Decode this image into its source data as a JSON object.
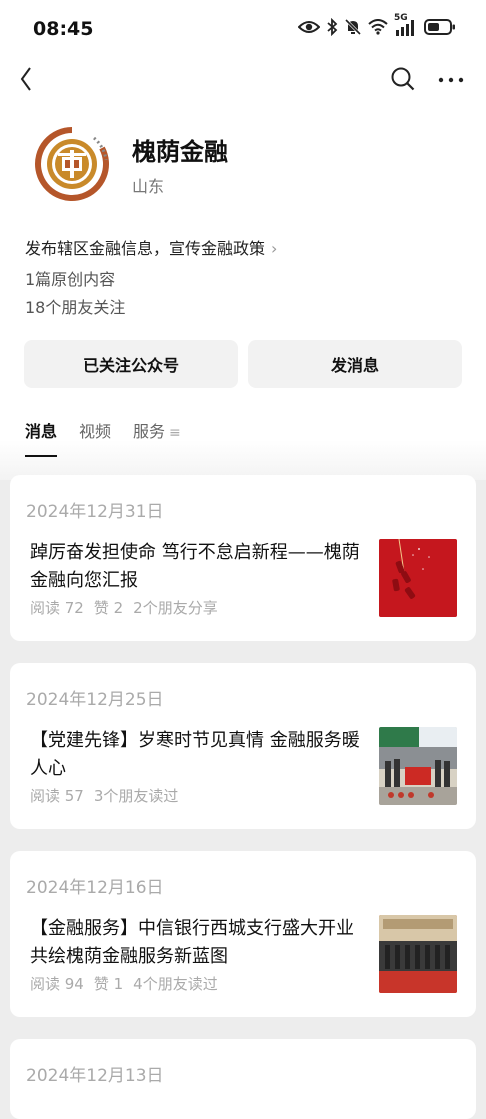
{
  "status_bar": {
    "time": "08:45",
    "network": "5G"
  },
  "account": {
    "name": "槐荫金融",
    "region": "山东",
    "description": "发布辖区金融信息，宣传金融政策",
    "original_count": "1篇原创内容",
    "friends_following": "18个朋友关注"
  },
  "buttons": {
    "follow": "已关注公众号",
    "message": "发消息"
  },
  "tabs": [
    {
      "label": "消息"
    },
    {
      "label": "视频"
    },
    {
      "label": "服务"
    }
  ],
  "articles": [
    {
      "date": "2024年12月31日",
      "title": "踔厉奋发担使命 笃行不怠启新程——槐荫金融向您汇报",
      "reads": "阅读 72",
      "likes": "赞 2",
      "social": "2个朋友分享"
    },
    {
      "date": "2024年12月25日",
      "title": "【党建先锋】岁寒时节见真情 金融服务暖人心",
      "reads": "阅读 57",
      "social": "3个朋友读过"
    },
    {
      "date": "2024年12月16日",
      "title": "【金融服务】中信银行西城支行盛大开业共绘槐荫金融服务新蓝图",
      "reads": "阅读 94",
      "likes": "赞 1",
      "social": "4个朋友读过"
    },
    {
      "date": "2024年12月13日"
    }
  ]
}
